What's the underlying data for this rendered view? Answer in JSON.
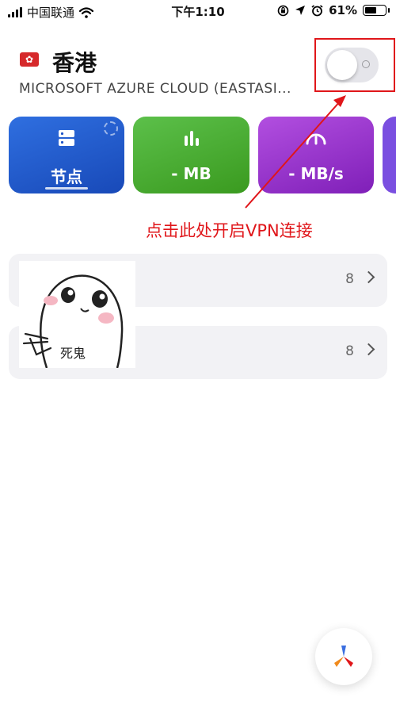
{
  "status_bar": {
    "carrier": "中国联通",
    "time": "下午1:10",
    "battery": "61%",
    "battery_level": 0.61
  },
  "header": {
    "flag_emoji": "🇭🇰",
    "location": "香港",
    "server": "MICROSOFT AZURE CLOUD (EASTASI..."
  },
  "vpn_toggle": {
    "state": "off"
  },
  "stats": {
    "nodes_label": "节点",
    "traffic_label": "- MB",
    "speed_label": "- MB/s"
  },
  "annotation": {
    "text": "点击此处开启VPN连接",
    "color": "#e0161a"
  },
  "groups": [
    {
      "count": "8"
    },
    {
      "count": "8"
    }
  ],
  "sticker": {
    "text": "死鬼"
  },
  "colors": {
    "nodes_card": "#1f56c8",
    "traffic_card": "#48ac32",
    "speed_card": "#9333cc",
    "highlight": "#e0161a"
  }
}
